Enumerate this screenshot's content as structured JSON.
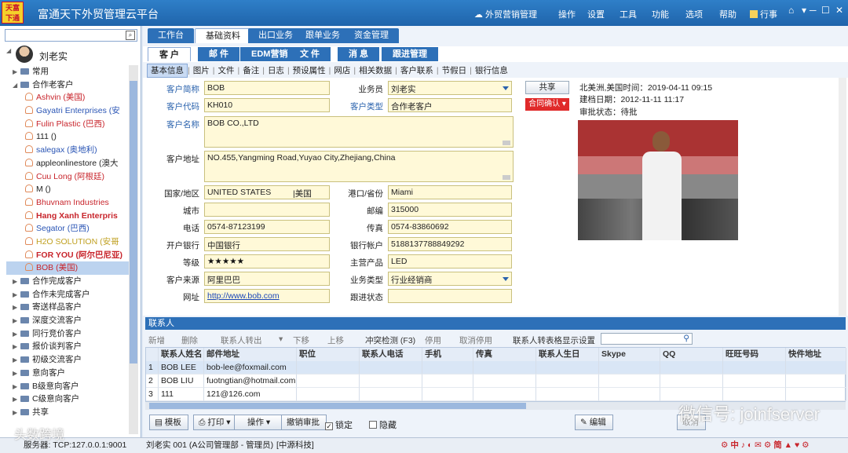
{
  "app": {
    "logo_text": "天富下通",
    "title": "富通天下外贸管理云平台"
  },
  "top_menu": [
    {
      "label": "☁ 外贸营销管理"
    },
    {
      "label": "操作"
    },
    {
      "label": "设置"
    },
    {
      "label": "工具"
    },
    {
      "label": "功能"
    },
    {
      "label": "选项"
    },
    {
      "label": "帮助"
    },
    {
      "label": "行事"
    }
  ],
  "window_buttons": {
    "home": "⌂",
    "skin": "▾",
    "min": "─",
    "max": "☐",
    "close": "✕"
  },
  "sidebar": {
    "search_placeholder": "",
    "user": "刘老实",
    "tree": [
      {
        "type": "group",
        "label": "常用",
        "color": "#222",
        "bold": false,
        "indent": 1
      },
      {
        "type": "group",
        "label": "合作老客户",
        "color": "#222",
        "bold": false,
        "indent": 1,
        "open": true
      },
      {
        "type": "person",
        "label": "Ashvin (美国)",
        "color": "#c8252c",
        "bold": false,
        "indent": 3
      },
      {
        "type": "person",
        "label": "Gayatri Enterprises (安",
        "color": "#2a55b5",
        "bold": false,
        "indent": 3
      },
      {
        "type": "person",
        "label": "Fulin Plastic (巴西)",
        "color": "#c8252c",
        "bold": false,
        "indent": 3
      },
      {
        "type": "person",
        "label": "111 ()",
        "color": "#222",
        "bold": false,
        "indent": 3
      },
      {
        "type": "person",
        "label": "salegax (奥地利)",
        "color": "#2a55b5",
        "bold": false,
        "indent": 3
      },
      {
        "type": "person",
        "label": "appleonlinestore (澳大",
        "color": "#222",
        "bold": false,
        "indent": 3
      },
      {
        "type": "person",
        "label": "Cuu Long (阿根廷)",
        "color": "#c8252c",
        "bold": false,
        "indent": 3
      },
      {
        "type": "person",
        "label": "M ()",
        "color": "#222",
        "bold": false,
        "indent": 3
      },
      {
        "type": "person",
        "label": "Bhuvnam Industries",
        "color": "#c8252c",
        "bold": false,
        "indent": 3
      },
      {
        "type": "person",
        "label": "Hang Xanh Enterpris",
        "color": "#c8252c",
        "bold": true,
        "indent": 3
      },
      {
        "type": "person",
        "label": "Segator (巴西)",
        "color": "#2a55b5",
        "bold": false,
        "indent": 3
      },
      {
        "type": "person",
        "label": "H2O SOLUTION (安哥",
        "color": "#c0a020",
        "bold": false,
        "indent": 3
      },
      {
        "type": "person",
        "label": "FOR YOU (阿尔巴尼亚)",
        "color": "#c8252c",
        "bold": true,
        "indent": 3
      },
      {
        "type": "person",
        "label": "BOB (美国)",
        "color": "#c8252c",
        "bold": false,
        "indent": 3,
        "selected": true
      },
      {
        "type": "group",
        "label": "合作完成客户",
        "color": "#222",
        "bold": false,
        "indent": 1
      },
      {
        "type": "group",
        "label": "合作未完成客户",
        "color": "#222",
        "bold": false,
        "indent": 1
      },
      {
        "type": "group",
        "label": "寄送样品客户",
        "color": "#222",
        "bold": false,
        "indent": 1
      },
      {
        "type": "group",
        "label": "深度交流客户",
        "color": "#222",
        "bold": false,
        "indent": 1
      },
      {
        "type": "group",
        "label": "同行竞价客户",
        "color": "#222",
        "bold": false,
        "indent": 1
      },
      {
        "type": "group",
        "label": "报价谈判客户",
        "color": "#222",
        "bold": false,
        "indent": 1
      },
      {
        "type": "group",
        "label": "初级交流客户",
        "color": "#222",
        "bold": false,
        "indent": 1
      },
      {
        "type": "group",
        "label": "意向客户",
        "color": "#222",
        "bold": false,
        "indent": 1
      },
      {
        "type": "group",
        "label": "B级意向客户",
        "color": "#222",
        "bold": false,
        "indent": 1
      },
      {
        "type": "group",
        "label": "C级意向客户",
        "color": "#222",
        "bold": false,
        "indent": 1
      },
      {
        "type": "group",
        "label": "共享",
        "color": "#222",
        "bold": false,
        "indent": 1
      }
    ]
  },
  "tabs_l1": [
    {
      "label": "工作台"
    },
    {
      "label": "基础资料",
      "active": true
    },
    {
      "label": "出口业务"
    },
    {
      "label": "跟单业务"
    },
    {
      "label": "资金管理"
    }
  ],
  "tabs_l2": [
    {
      "label": "客 户",
      "active": true
    },
    {
      "label": "邮 件"
    },
    {
      "label": "EDM营销"
    },
    {
      "label": "文 件"
    },
    {
      "label": "消 息"
    },
    {
      "label": "跟进管理"
    }
  ],
  "tabs_l3": [
    "基本信息",
    "图片",
    "文件",
    "备注",
    "日志",
    "预设属性",
    "网店",
    "相关数据",
    "客户联系",
    "节假日",
    "银行信息"
  ],
  "form": {
    "short_name_label": "客户简称",
    "short_name": "BOB",
    "code_label": "客户代码",
    "code": "KH010",
    "name_label": "客户名称",
    "name": "BOB CO.,LTD",
    "address_label": "客户地址",
    "address": "NO.455,Yangming Road,Yuyao City,Zhejiang,China",
    "country_label": "国家/地区",
    "country": "UNITED STATES",
    "country_cn": "|美国",
    "city_label": "城市",
    "city": "",
    "phone_label": "电话",
    "phone": "0574-87123199",
    "bank_label": "开户银行",
    "bank": "中国银行",
    "grade_label": "等级",
    "grade": "★★★★★",
    "source_label": "客户来源",
    "source": "阿里巴巴",
    "website_label": "网址",
    "website": "http://www.bob.com",
    "salesman_label": "业务员",
    "salesman": "刘老实",
    "type_label": "客户类型",
    "type": "合作老客户",
    "port_label": "港口/省份",
    "port": "Miami",
    "zip_label": "邮编",
    "zip": "315000",
    "fax_label": "传真",
    "fax": "0574-83860692",
    "account_label": "银行帐户",
    "account": "5188137788849292",
    "product_label": "主营产品",
    "product": "LED",
    "biztype_label": "业务类型",
    "biztype": "行业经销商",
    "follow_label": "跟进状态",
    "follow": ""
  },
  "side_buttons": {
    "share": "共享",
    "contract": "合同确认 ▾"
  },
  "info": {
    "local_time": "北美洲,美国时间：2019-04-11 09:15",
    "created": "建档日期：2012-11-11 11:17",
    "approval": "审批状态：待批"
  },
  "contacts": {
    "header": "联系人",
    "toolbar": [
      {
        "label": "新增",
        "dim": true
      },
      {
        "label": "删除",
        "dim": true
      },
      {
        "label": "联系人转出",
        "dim": true
      },
      {
        "label": "▾",
        "dim": true
      },
      {
        "label": "下移",
        "dim": true
      },
      {
        "label": "上移",
        "dim": true
      },
      {
        "label": "冲突检测 (F3)",
        "dim": false
      },
      {
        "label": "停用",
        "dim": true
      },
      {
        "label": "取消停用",
        "dim": true
      },
      {
        "label": "联系人转表格显示设置",
        "dim": false
      }
    ],
    "columns": [
      "",
      "联系人姓名",
      "邮件地址",
      "职位",
      "联系人电话",
      "手机",
      "传真",
      "联系人生日",
      "Skype",
      "QQ",
      "旺旺号码",
      "快件地址"
    ],
    "rows": [
      [
        "1",
        "BOB LEE",
        "bob-lee@foxmail.com",
        "",
        "",
        "",
        "",
        "",
        "",
        "",
        "",
        ""
      ],
      [
        "2",
        "BOB LIU",
        "fuotngtian@hotmail.com",
        "",
        "",
        "",
        "",
        "",
        "",
        "",
        "",
        ""
      ],
      [
        "3",
        "111",
        "121@126.com",
        "",
        "",
        "",
        "",
        "",
        "",
        "",
        "",
        ""
      ]
    ]
  },
  "bottom_bar": {
    "template": "模板",
    "print": "打印",
    "operate": "操作",
    "revoke": "撤销审批",
    "lock": "锁定",
    "hide": "隐藏",
    "edit": "编辑",
    "cancel": "取消"
  },
  "status_bar": {
    "left": "服务器: TCP:127.0.0.1:9001",
    "user": "刘老实 001 (A公司管理部 - 管理员)",
    "company": "[中源科技]",
    "tray": "⚙ 中 ♪ ◐ ✉ ⚙ 简 ▲ ♥ ⚙"
  },
  "watermark": {
    "main": "微信号: joinfserver",
    "left": "头数跨境"
  }
}
